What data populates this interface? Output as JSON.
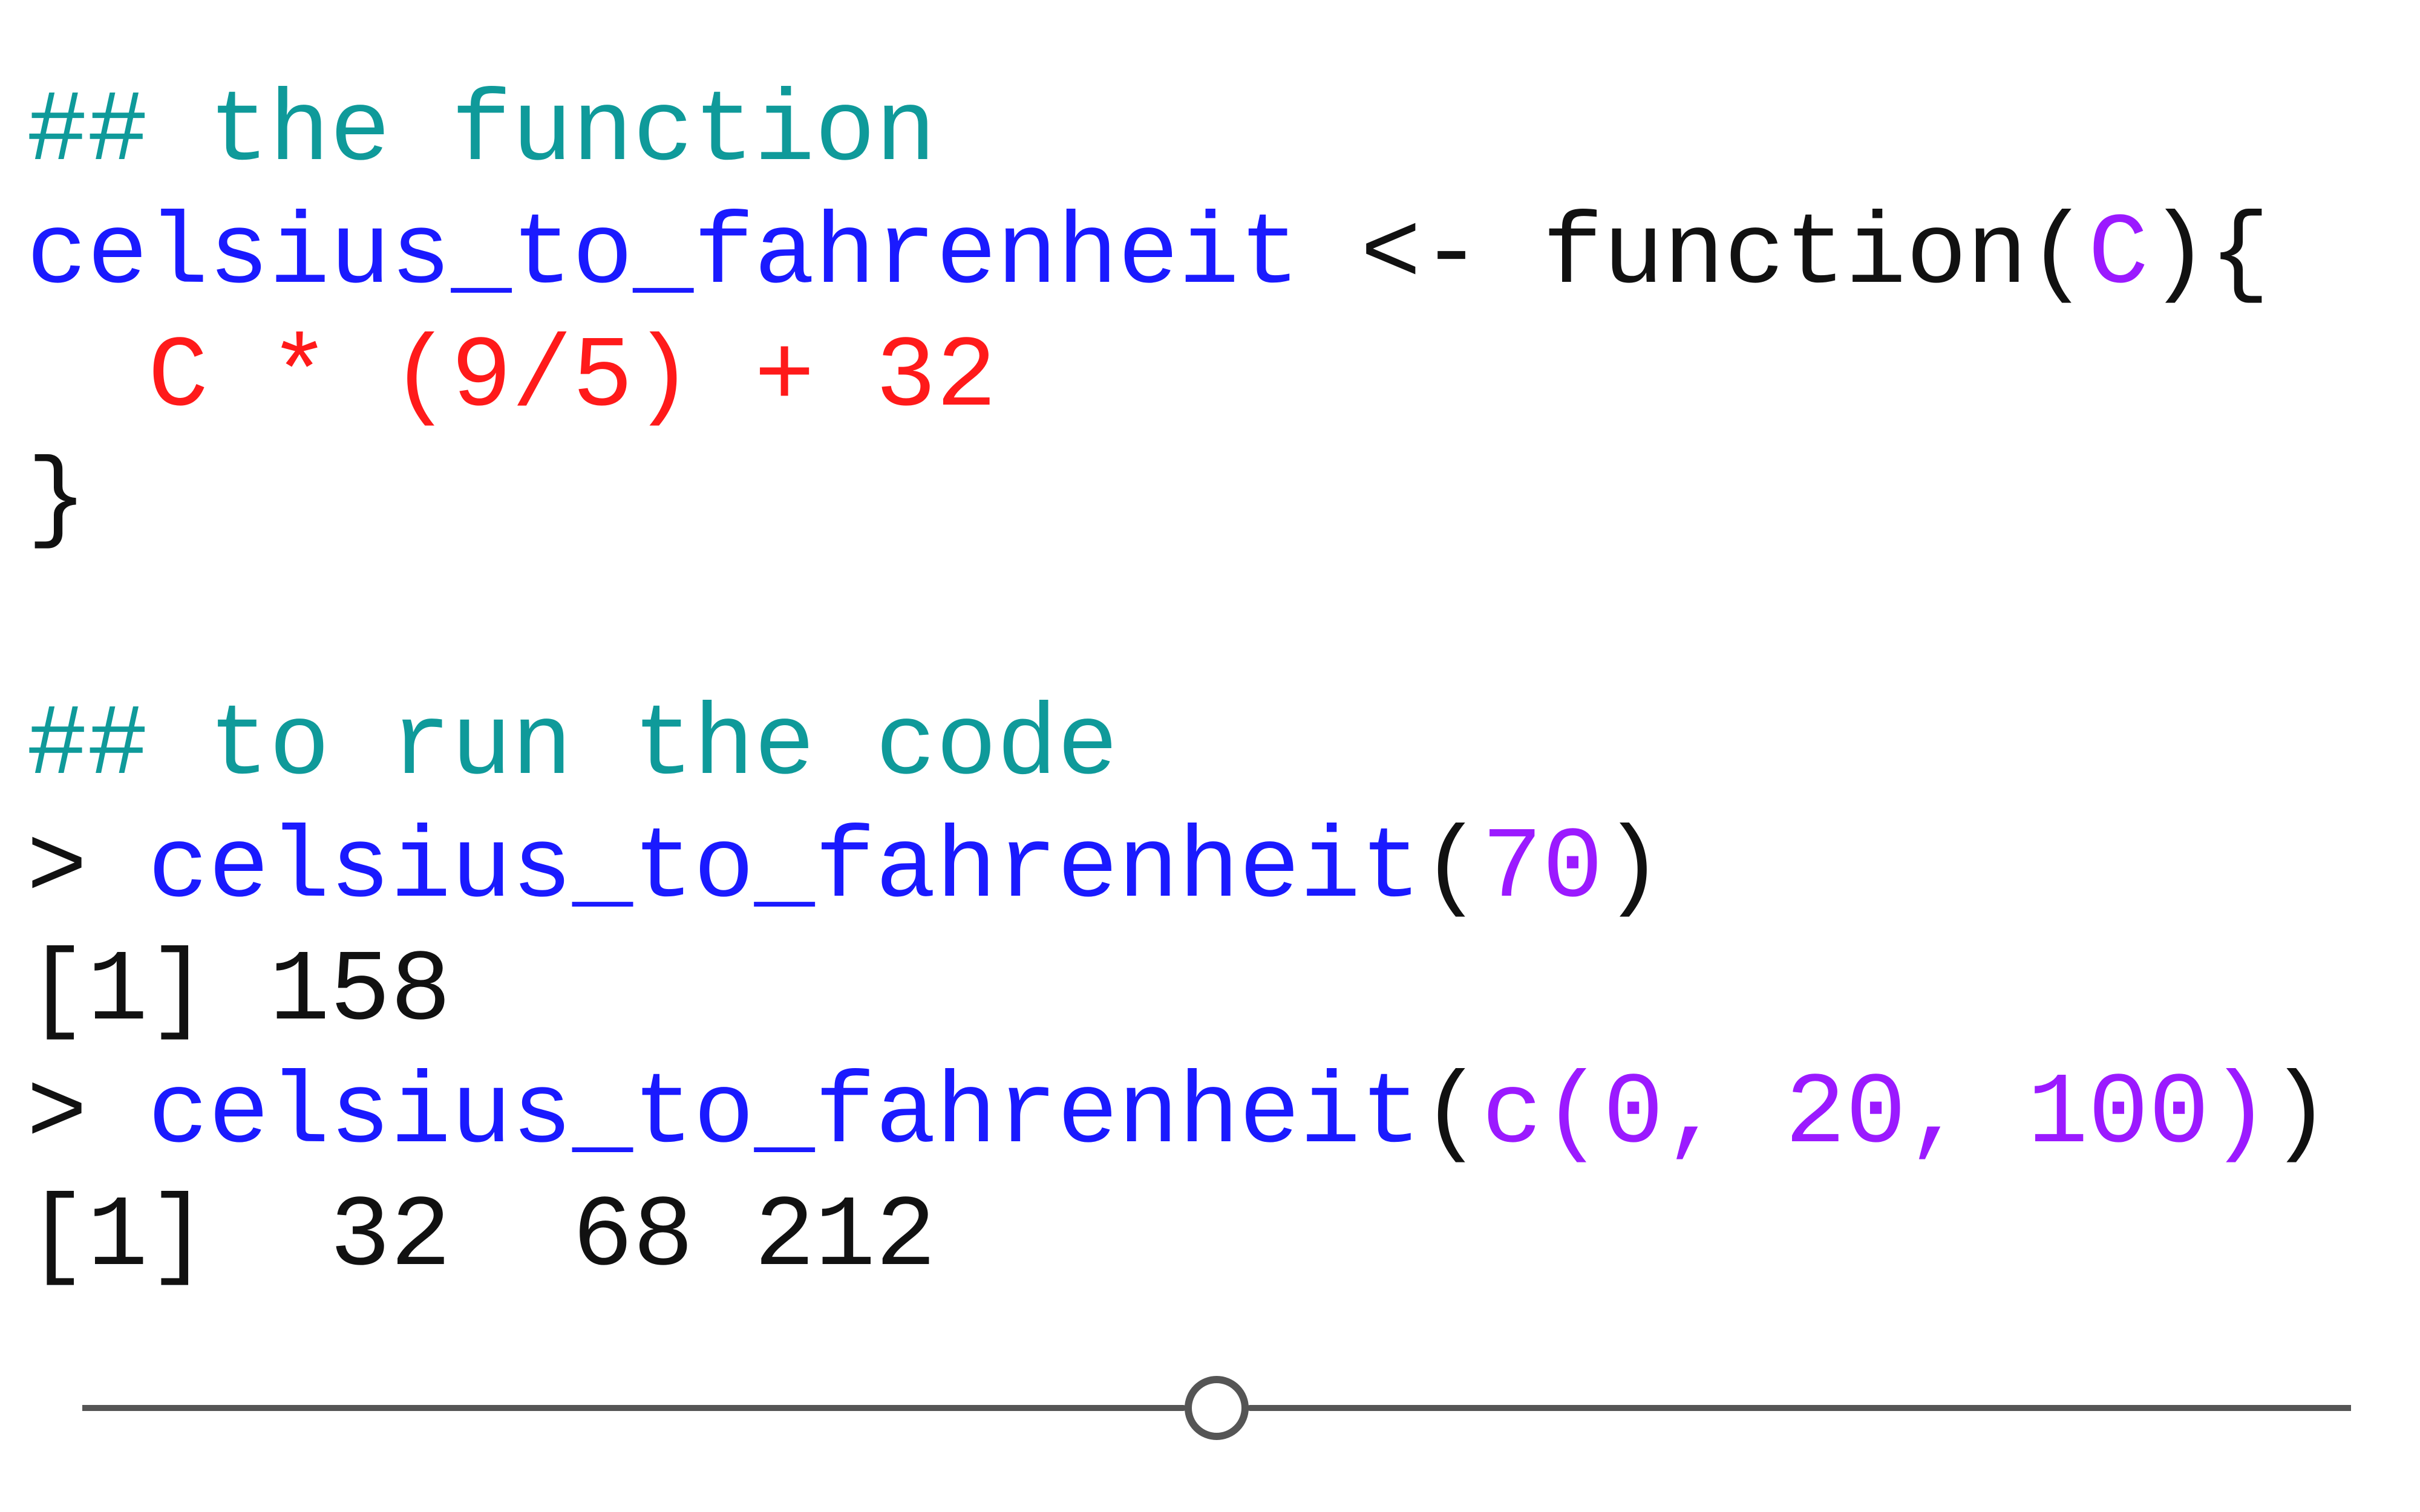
{
  "code": {
    "lines": [
      [
        {
          "text": "## the function",
          "type": "comment"
        }
      ],
      [
        {
          "text": "celsius_to_fahrenheit",
          "type": "func"
        },
        {
          "text": " <- function(",
          "type": "default"
        },
        {
          "text": "C",
          "type": "arg"
        },
        {
          "text": "){",
          "type": "default"
        }
      ],
      [
        {
          "text": "  ",
          "type": "default"
        },
        {
          "text": "C * (9/5) + 32",
          "type": "expr"
        }
      ],
      [
        {
          "text": "}",
          "type": "default"
        }
      ],
      [],
      [
        {
          "text": "## to run the code",
          "type": "comment"
        }
      ],
      [
        {
          "text": "> ",
          "type": "default"
        },
        {
          "text": "celsius_to_fahrenheit",
          "type": "func"
        },
        {
          "text": "(",
          "type": "default"
        },
        {
          "text": "70",
          "type": "arg"
        },
        {
          "text": ")",
          "type": "default"
        }
      ],
      [
        {
          "text": "[1] 158",
          "type": "default"
        }
      ],
      [
        {
          "text": "> ",
          "type": "default"
        },
        {
          "text": "celsius_to_fahrenheit",
          "type": "func"
        },
        {
          "text": "(",
          "type": "default"
        },
        {
          "text": "c(0, 20, 100)",
          "type": "arg"
        },
        {
          "text": ")",
          "type": "default"
        }
      ],
      [
        {
          "text": "[1]  32  68 212",
          "type": "default"
        }
      ]
    ]
  },
  "slider": {
    "value": 0.5
  },
  "colors": {
    "comment": "#0f9a9a",
    "func": "#1a1aff",
    "default": "#111111",
    "expr": "#ff1a1a",
    "arg": "#9b1aff",
    "slider": "#555555"
  }
}
